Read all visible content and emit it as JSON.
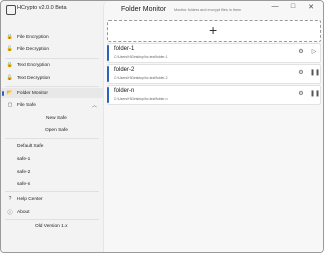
{
  "app": {
    "title": "HCrypto  v2.0.0 Beta"
  },
  "window_controls": {
    "minimize": "—",
    "maximize": "□",
    "close": "✕"
  },
  "sidebar": {
    "items": [
      {
        "icon": "🔒",
        "label": "File Encryption"
      },
      {
        "icon": "🔓",
        "label": "File Decryption"
      },
      {
        "icon": "🔒",
        "label": "Text Encryption"
      },
      {
        "icon": "🔓",
        "label": "Text Decryption"
      },
      {
        "icon": "📂",
        "label": "Folder Monitor"
      },
      {
        "icon": "▢",
        "label": "File Safe"
      }
    ],
    "safe_actions": {
      "new": "New Safe",
      "open": "Open Safe"
    },
    "safes": [
      "Default Safe",
      "safe-1",
      "safe-2",
      "safe-n"
    ],
    "footer": {
      "help": "Help Center",
      "about": "About",
      "old_version": "Old Version 1.x"
    }
  },
  "main": {
    "title": "Folder Monitor",
    "subtitle": "Monitor folders and encrypt files in them",
    "add_symbol": "+",
    "folders": [
      {
        "name": "folder-1",
        "path": "C:\\Users\\H\\Desktop\\hc-test\\folder-1"
      },
      {
        "name": "folder-2",
        "path": "C:\\Users\\H\\Desktop\\hc-test\\folder-2"
      },
      {
        "name": "folder-n",
        "path": "C:\\Users\\H\\Desktop\\hc-test\\folder-n"
      }
    ]
  },
  "colors": {
    "accent": "#2a63c2"
  }
}
